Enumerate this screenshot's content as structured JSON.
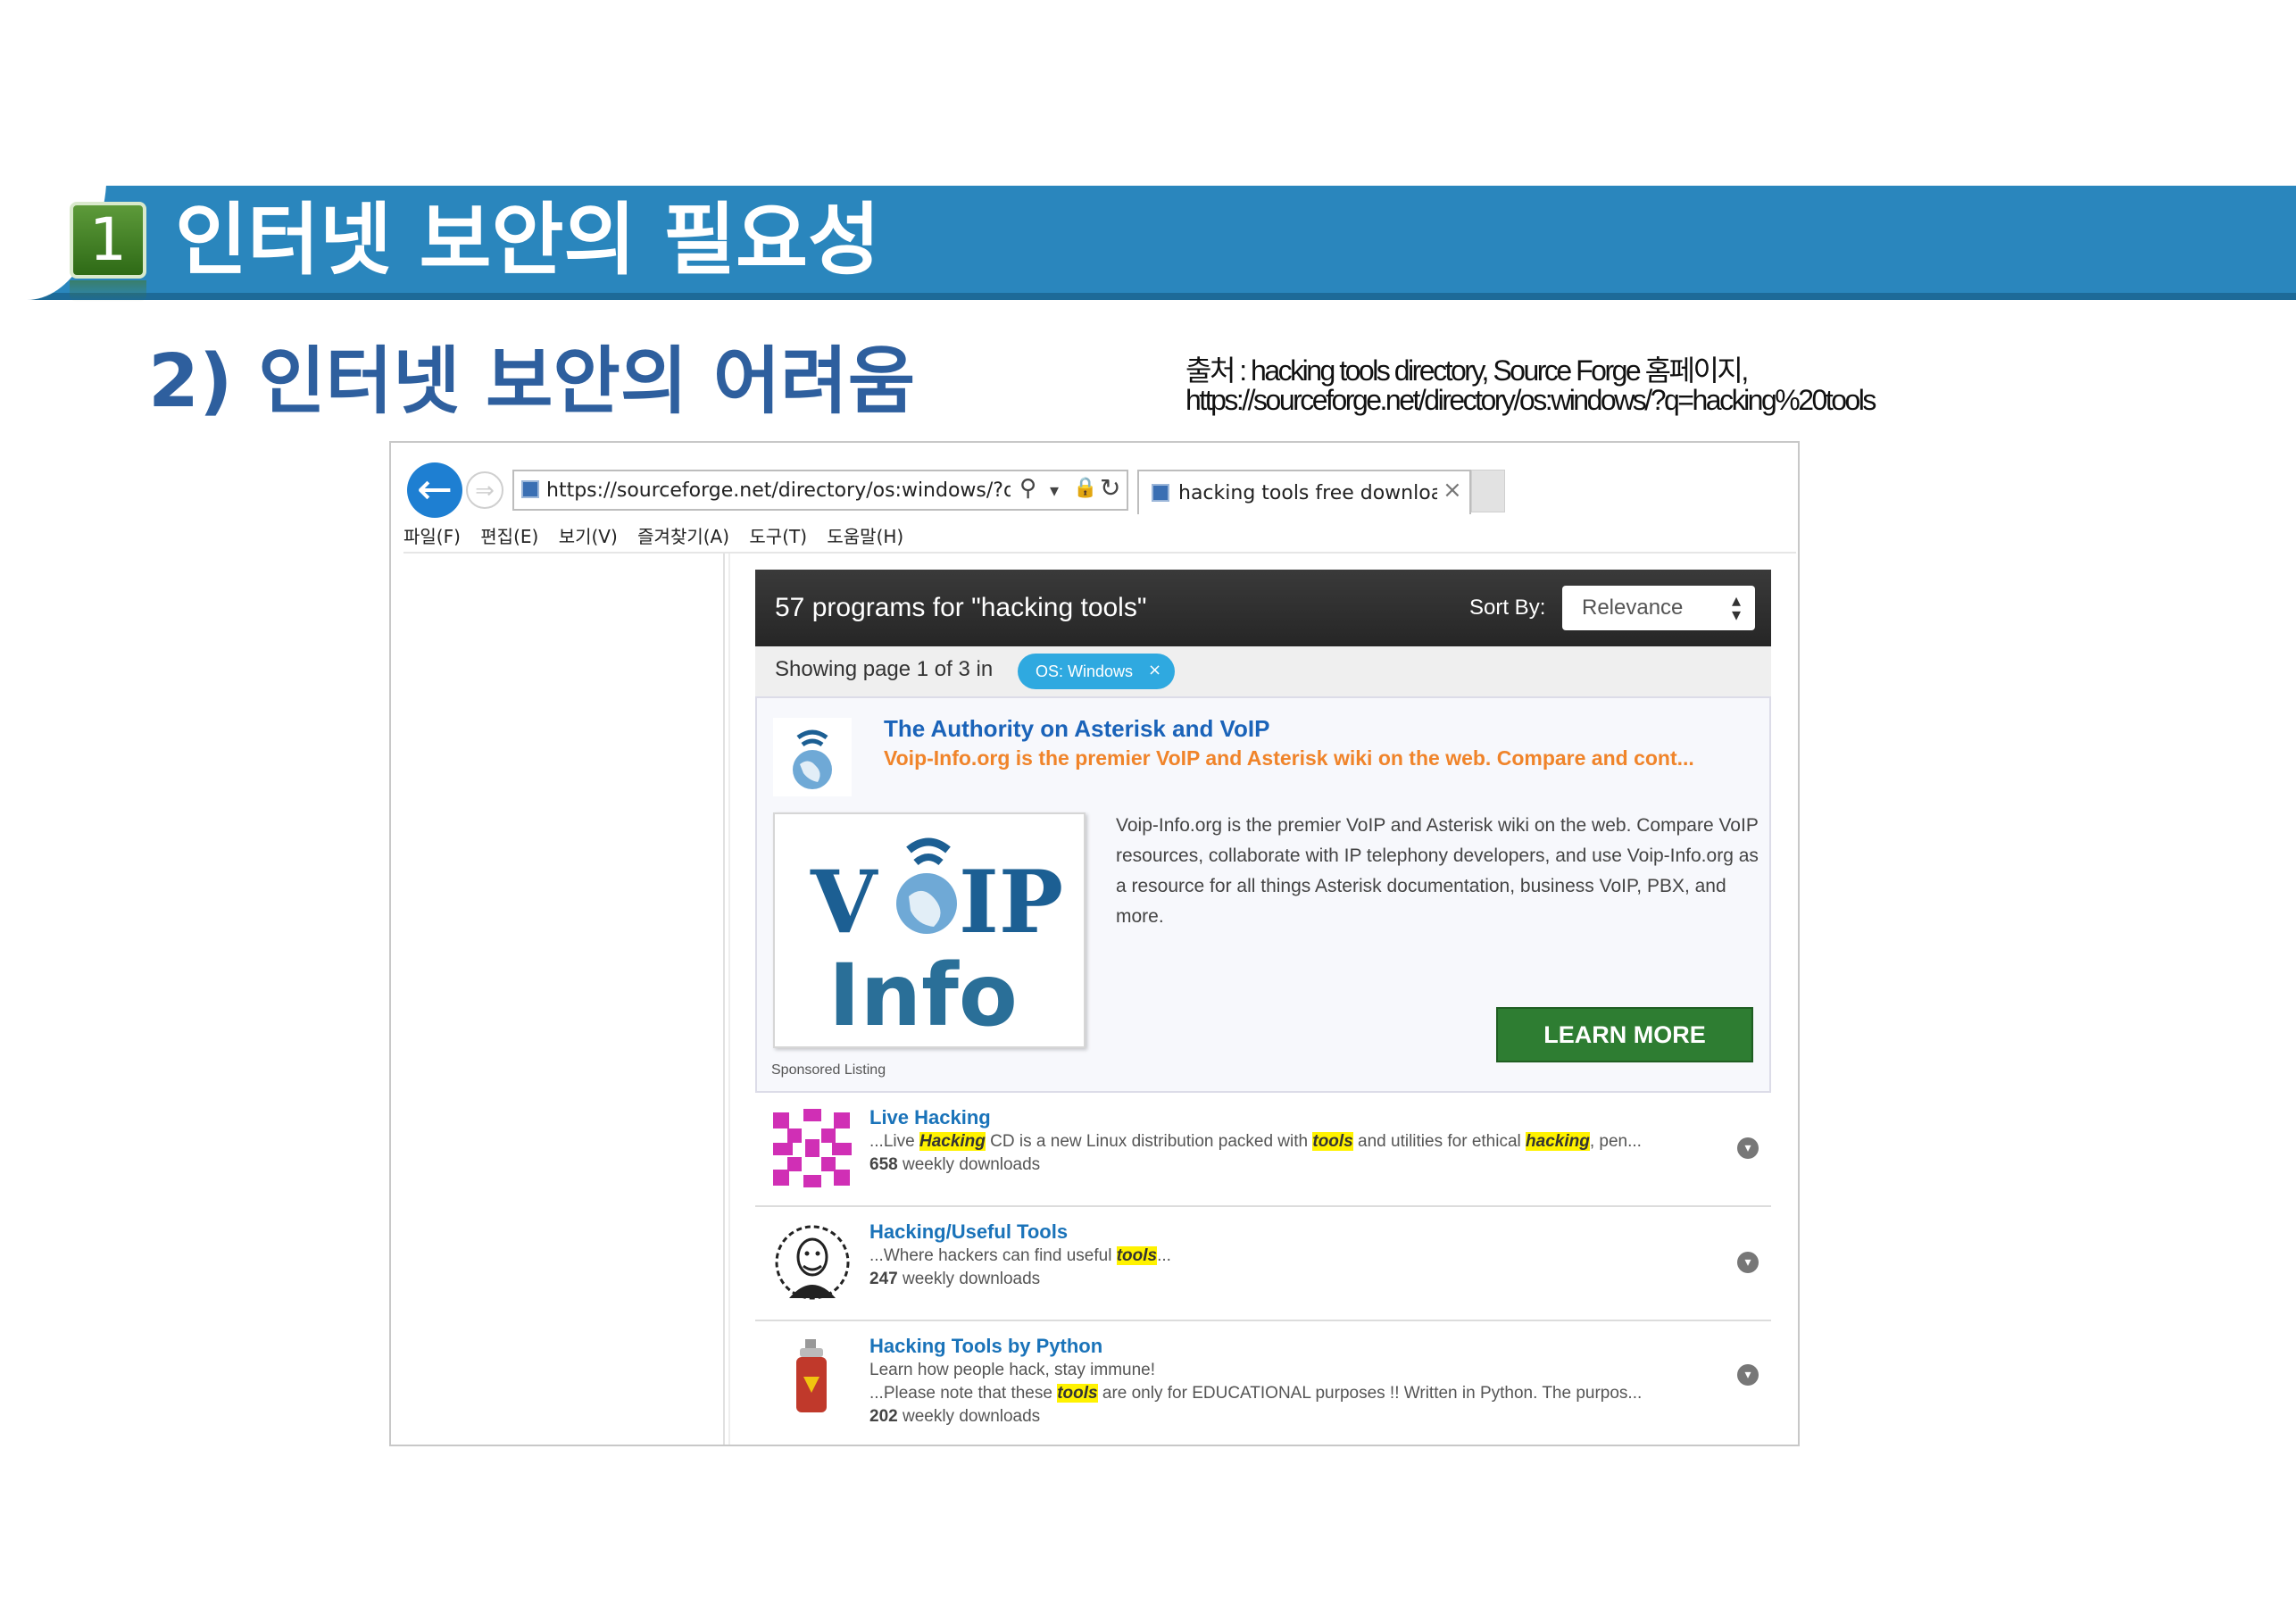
{
  "slide": {
    "section_number": "1",
    "title": "인터넷 보안의 필요성",
    "subtitle": "2) 인터넷 보안의 어려움",
    "source_line1": "출처 : hacking tools directory, Source Forge 홈페이지,",
    "source_line2": "https://sourceforge.net/directory/os:windows/?q=hacking%20tools"
  },
  "browser": {
    "url": "https://sourceforge.net/directory/os:windows/?q=hac",
    "tab_title": "hacking tools free downloa...",
    "menu": [
      "파일(F)",
      "편집(E)",
      "보기(V)",
      "즐겨찾기(A)",
      "도구(T)",
      "도움말(H)"
    ],
    "icons": {
      "back": "arrow-left-icon",
      "forward": "arrow-right-icon",
      "search": "search-icon",
      "lock": "lock-icon",
      "refresh": "refresh-icon",
      "close": "close-icon"
    }
  },
  "page": {
    "results_count": "57 programs for \"hacking tools\"",
    "sort_label": "Sort By:",
    "sort_value": "Relevance",
    "showing": "Showing page 1 of 3 in",
    "filter_chip": "OS: Windows",
    "sponsored": {
      "title": "The Authority on Asterisk and VoIP",
      "tagline": "Voip-Info.org is the premier VoIP and Asterisk wiki on the web. Compare and cont...",
      "logo_word1": "V",
      "logo_word2": "IP",
      "logo_word3": "Info",
      "description": "Voip-Info.org is the premier VoIP and Asterisk wiki on the web. Compare VoIP resources, collaborate with IP telephony developers, and use Voip-Info.org as a resource for all things Asterisk documentation, business VoIP, PBX, and more.",
      "button": "LEARN MORE",
      "label": "Sponsored Listing"
    },
    "results": [
      {
        "title": "Live Hacking",
        "desc_pre": "...Live ",
        "desc_hl1": "Hacking",
        "desc_mid": " CD is a new Linux distribution packed with ",
        "desc_hl2": "tools",
        "desc_mid2": " and utilities for ethical ",
        "desc_hl3": "hacking",
        "desc_post": ", pen...",
        "downloads_num": "658",
        "downloads_label": " weekly downloads"
      },
      {
        "title": "Hacking/Useful Tools",
        "desc_pre": "...Where hackers can find useful ",
        "desc_hl1": "tools",
        "desc_post": "...",
        "downloads_num": "247",
        "downloads_label": " weekly downloads"
      },
      {
        "title": "Hacking Tools by Python",
        "desc_line1": "Learn how people hack, stay immune!",
        "desc_pre": "...Please note that these ",
        "desc_hl1": "tools",
        "desc_post": " are only for EDUCATIONAL purposes !! Written in Python. The purpos...",
        "downloads_num": "202",
        "downloads_label": " weekly downloads"
      }
    ]
  },
  "colors": {
    "title_band": "#2a86bd",
    "subtitle_text": "#2e5f9e",
    "badge_green": "#2e6a16",
    "link_blue": "#1a73b9",
    "tagline_orange": "#f0842a",
    "button_green": "#2e7d32",
    "filter_chip": "#2fa9e0",
    "highlight": "#fff200"
  }
}
